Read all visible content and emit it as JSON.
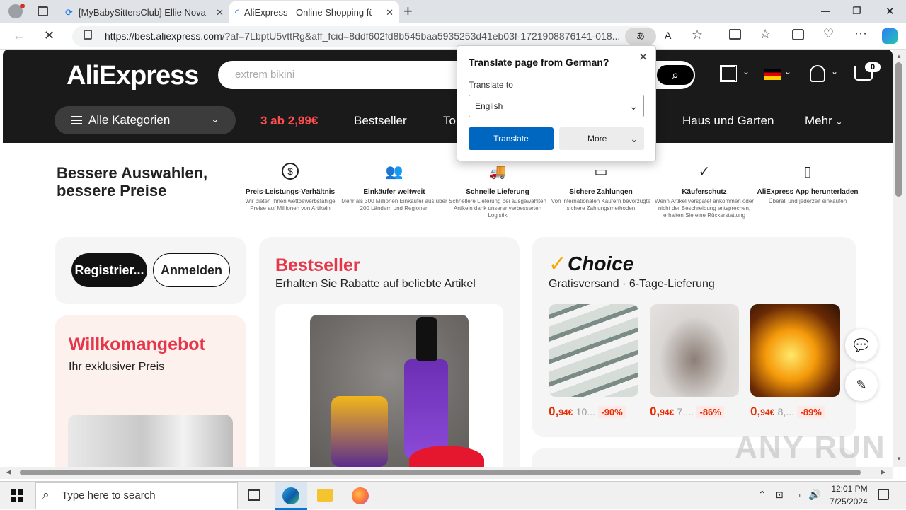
{
  "browser": {
    "tabs": [
      {
        "title": "[MyBabySittersClub] Ellie Nova (A",
        "close": "✕"
      },
      {
        "title": "AliExpress - Online Shopping für",
        "close": "✕"
      }
    ],
    "new_tab": "+",
    "url_host": "https://best.aliexpress.com",
    "url_rest": "/?af=7LbptU5vttRg&aff_fcid=8ddf602fd8b545baa5935253d41eb03f-1721908876141-018...",
    "window_controls": [
      "—",
      "❐",
      "✕"
    ]
  },
  "translate_popup": {
    "title": "Translate page from German?",
    "label": "Translate to",
    "selected_language": "English",
    "translate_button": "Translate",
    "more_button": "More"
  },
  "site": {
    "logo": "AliExpress",
    "search_placeholder": "extrem bikini",
    "cart_count": "0",
    "categories_button": "Alle Kategorien",
    "nav": {
      "promo": "3 ab 2,99€",
      "bestseller": "Bestseller",
      "partial": "To",
      "home": "Haus und Garten",
      "more": "Mehr"
    }
  },
  "hero": {
    "headline_line1": "Bessere Auswahlen,",
    "headline_line2": "bessere Preise",
    "features": [
      {
        "title": "Preis-Leistungs-Verhältnis",
        "desc": "Wir bieten Ihnen wettbewerbsfähige Preise auf Millionen von Artikeln",
        "icon": "$"
      },
      {
        "title": "Einkäufer weltweit",
        "desc": "Mehr als 300 Millionen Einkäufer aus über 200 Ländern und Regionen",
        "icon": "👥"
      },
      {
        "title": "Schnelle Lieferung",
        "desc": "Schnellere Lieferung bei ausgewählten Artikeln dank unserer verbesserten Logistik",
        "icon": "🚚"
      },
      {
        "title": "Sichere Zahlungen",
        "desc": "Von internationalen Käufern bevorzugte sichere Zahlungsmethoden",
        "icon": "▭"
      },
      {
        "title": "Käuferschutz",
        "desc": "Wenn Artikel verspätet ankommen oder nicht der Beschreibung entsprechen, erhalten Sie eine Rückerstattung",
        "icon": "✓"
      },
      {
        "title": "AliExpress App herunterladen",
        "desc": "Überall und jederzeit einkaufen",
        "icon": "▯"
      }
    ]
  },
  "account": {
    "register": "Registrier...",
    "login": "Anmelden"
  },
  "welcome": {
    "title": "Willkomangebot",
    "subtitle": "Ihr exklusiver Preis"
  },
  "bestseller": {
    "title": "Bestseller",
    "subtitle": "Erhalten Sie Rabatte auf beliebte Artikel"
  },
  "choice": {
    "logo": "Choice",
    "subtitle": "Gratisversand · 6-Tage-Lieferung",
    "products": [
      {
        "price_int": "0,",
        "price_dec": "94€",
        "old": "10...",
        "discount": "-90%"
      },
      {
        "price_int": "0,",
        "price_dec": "94€",
        "old": "7,...",
        "discount": "-86%"
      },
      {
        "price_int": "0,",
        "price_dec": "94€",
        "old": "8,...",
        "discount": "-89%"
      }
    ]
  },
  "taskbar": {
    "search_placeholder": "Type here to search",
    "time": "12:01 PM",
    "date": "7/25/2024"
  },
  "watermark": "ANY RUN",
  "colors": {
    "ali_red": "#e62e04",
    "translate_blue": "#0067c0",
    "header_bg": "#1a1a1a"
  }
}
